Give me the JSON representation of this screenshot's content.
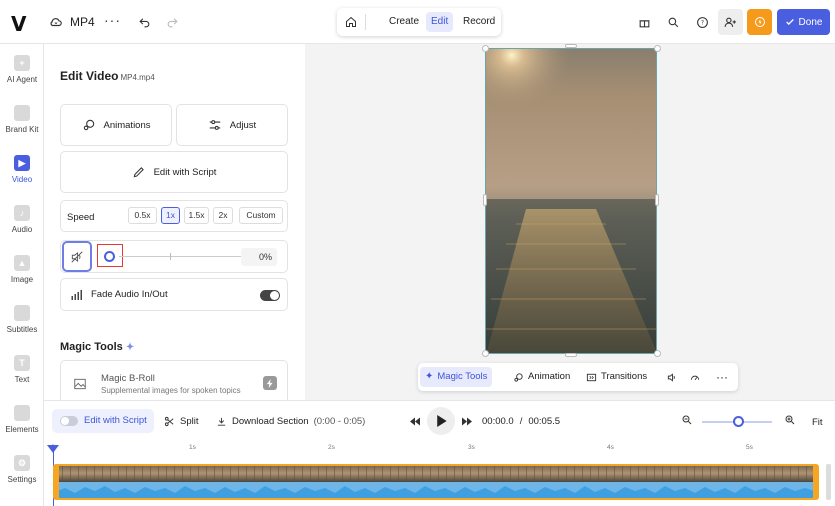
{
  "app": {
    "logo": "V",
    "project_title": "MP4",
    "more": "···"
  },
  "modes": {
    "home_icon": "home-icon",
    "items": [
      {
        "label": "Create",
        "active": false
      },
      {
        "label": "Edit",
        "active": true
      },
      {
        "label": "Record",
        "active": false
      }
    ]
  },
  "toolbar": {
    "done_label": "Done",
    "accent": "#4a5fe0",
    "upgrade_color": "#f59a1b"
  },
  "nav": {
    "items": [
      {
        "label": "AI Agent",
        "glyph": "+",
        "active": false
      },
      {
        "label": "Brand Kit",
        "glyph": "",
        "active": false
      },
      {
        "label": "Video",
        "glyph": "▶",
        "active": true
      },
      {
        "label": "Audio",
        "glyph": "♪",
        "active": false
      },
      {
        "label": "Image",
        "glyph": "▲",
        "active": false
      },
      {
        "label": "Subtitles",
        "glyph": "",
        "active": false
      },
      {
        "label": "Text",
        "glyph": "T",
        "active": false
      },
      {
        "label": "Elements",
        "glyph": "",
        "active": false
      },
      {
        "label": "Settings",
        "glyph": "⚙",
        "active": false
      }
    ]
  },
  "panel": {
    "title": "Edit Video",
    "filename": "MP4.mp4",
    "animations_label": "Animations",
    "adjust_label": "Adjust",
    "script_label": "Edit with Script",
    "speed_label": "Speed",
    "speed_options": [
      "0.5x",
      "1x",
      "1.5x",
      "2x",
      "Custom"
    ],
    "speed_selected": "1x",
    "volume_value": "0%",
    "fade_label": "Fade Audio In/Out",
    "magic_tools_title": "Magic Tools",
    "magic_broll_title": "Magic B-Roll",
    "magic_broll_desc": "Supplemental images for spoken topics"
  },
  "video_toolbar": {
    "magic_tools": "Magic Tools",
    "animation": "Animation",
    "transitions": "Transitions",
    "more": "···"
  },
  "timeline": {
    "edit_script": "Edit with Script",
    "split": "Split",
    "download": "Download Section",
    "download_range": "(0:00 - 0:05)",
    "current_time": "00:00.0",
    "separator": "/",
    "total_time": "00:05.5",
    "fit": "Fit",
    "ticks": [
      "0",
      "1s",
      "2s",
      "3s",
      "4s",
      "5s"
    ],
    "track_color": "#f5a623"
  }
}
